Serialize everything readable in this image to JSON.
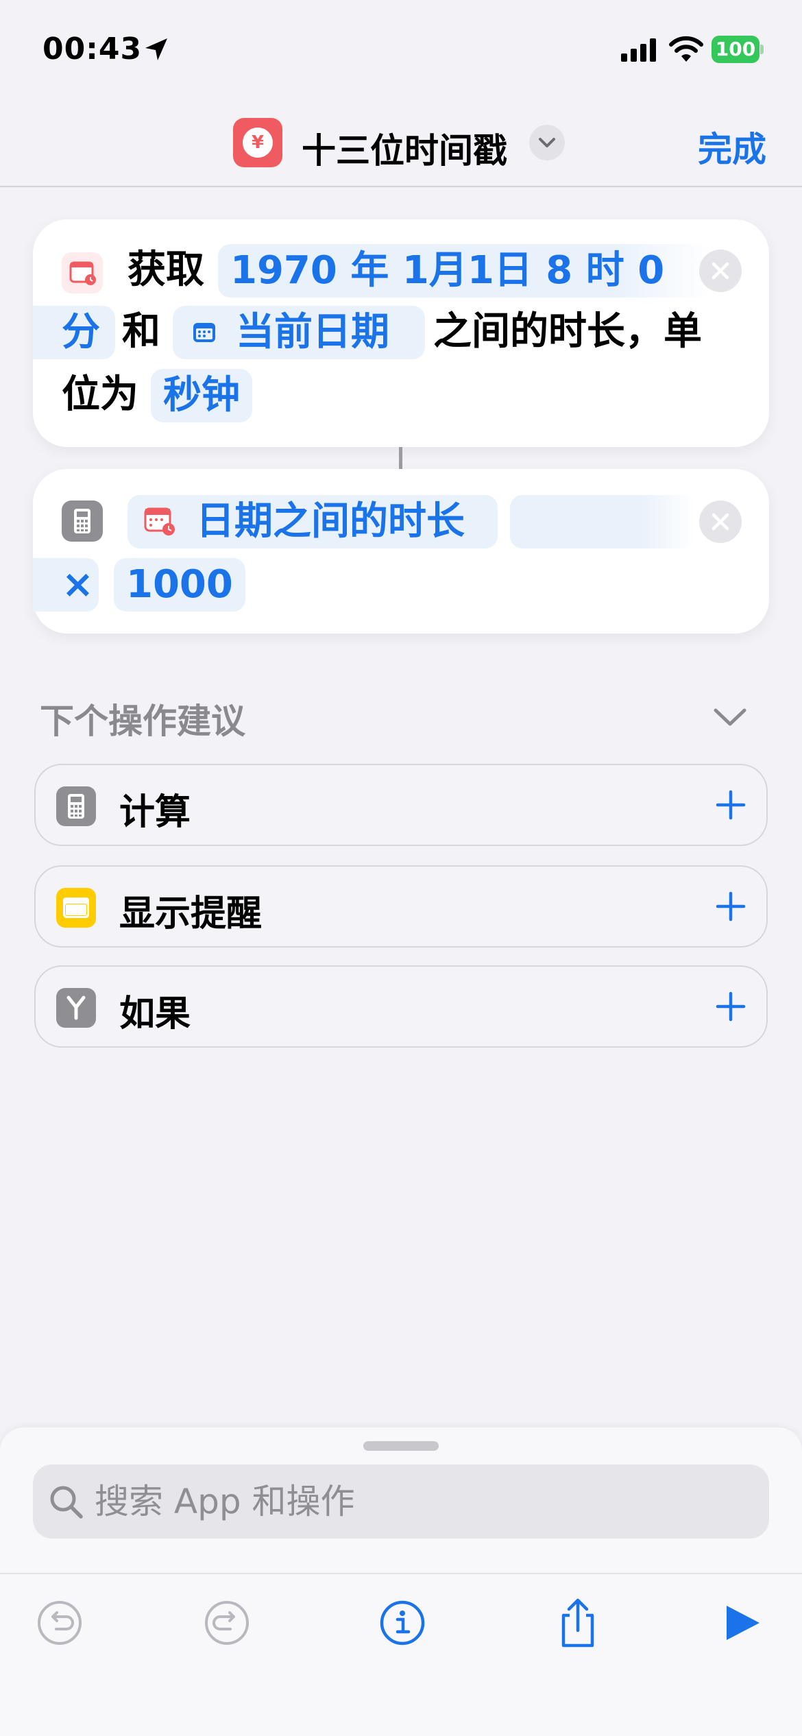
{
  "status_bar": {
    "time": "00:43",
    "battery": "100"
  },
  "nav": {
    "title": "十三位时间戳",
    "done_label": "完成"
  },
  "action1": {
    "get": "获取",
    "start_date_line1": "1970 年 1月1日 8 时 0",
    "start_date_line2": "分",
    "and": "和",
    "current_date": "当前日期",
    "between": "之间的时长，单",
    "unit_prefix": "位为",
    "unit": "秒钟"
  },
  "action2": {
    "variable": "日期之间的时长",
    "operator": "×",
    "operand": "1000"
  },
  "suggestions": {
    "header": "下个操作建议",
    "items": [
      {
        "label": "计算",
        "icon": "calculator-icon"
      },
      {
        "label": "显示提醒",
        "icon": "alert-icon"
      },
      {
        "label": "如果",
        "icon": "if-branch-icon"
      }
    ]
  },
  "search": {
    "placeholder": "搜索 App 和操作"
  },
  "colors": {
    "accent": "#1a73e8",
    "battery": "#34c759",
    "shortcut": "#ef5b60"
  }
}
